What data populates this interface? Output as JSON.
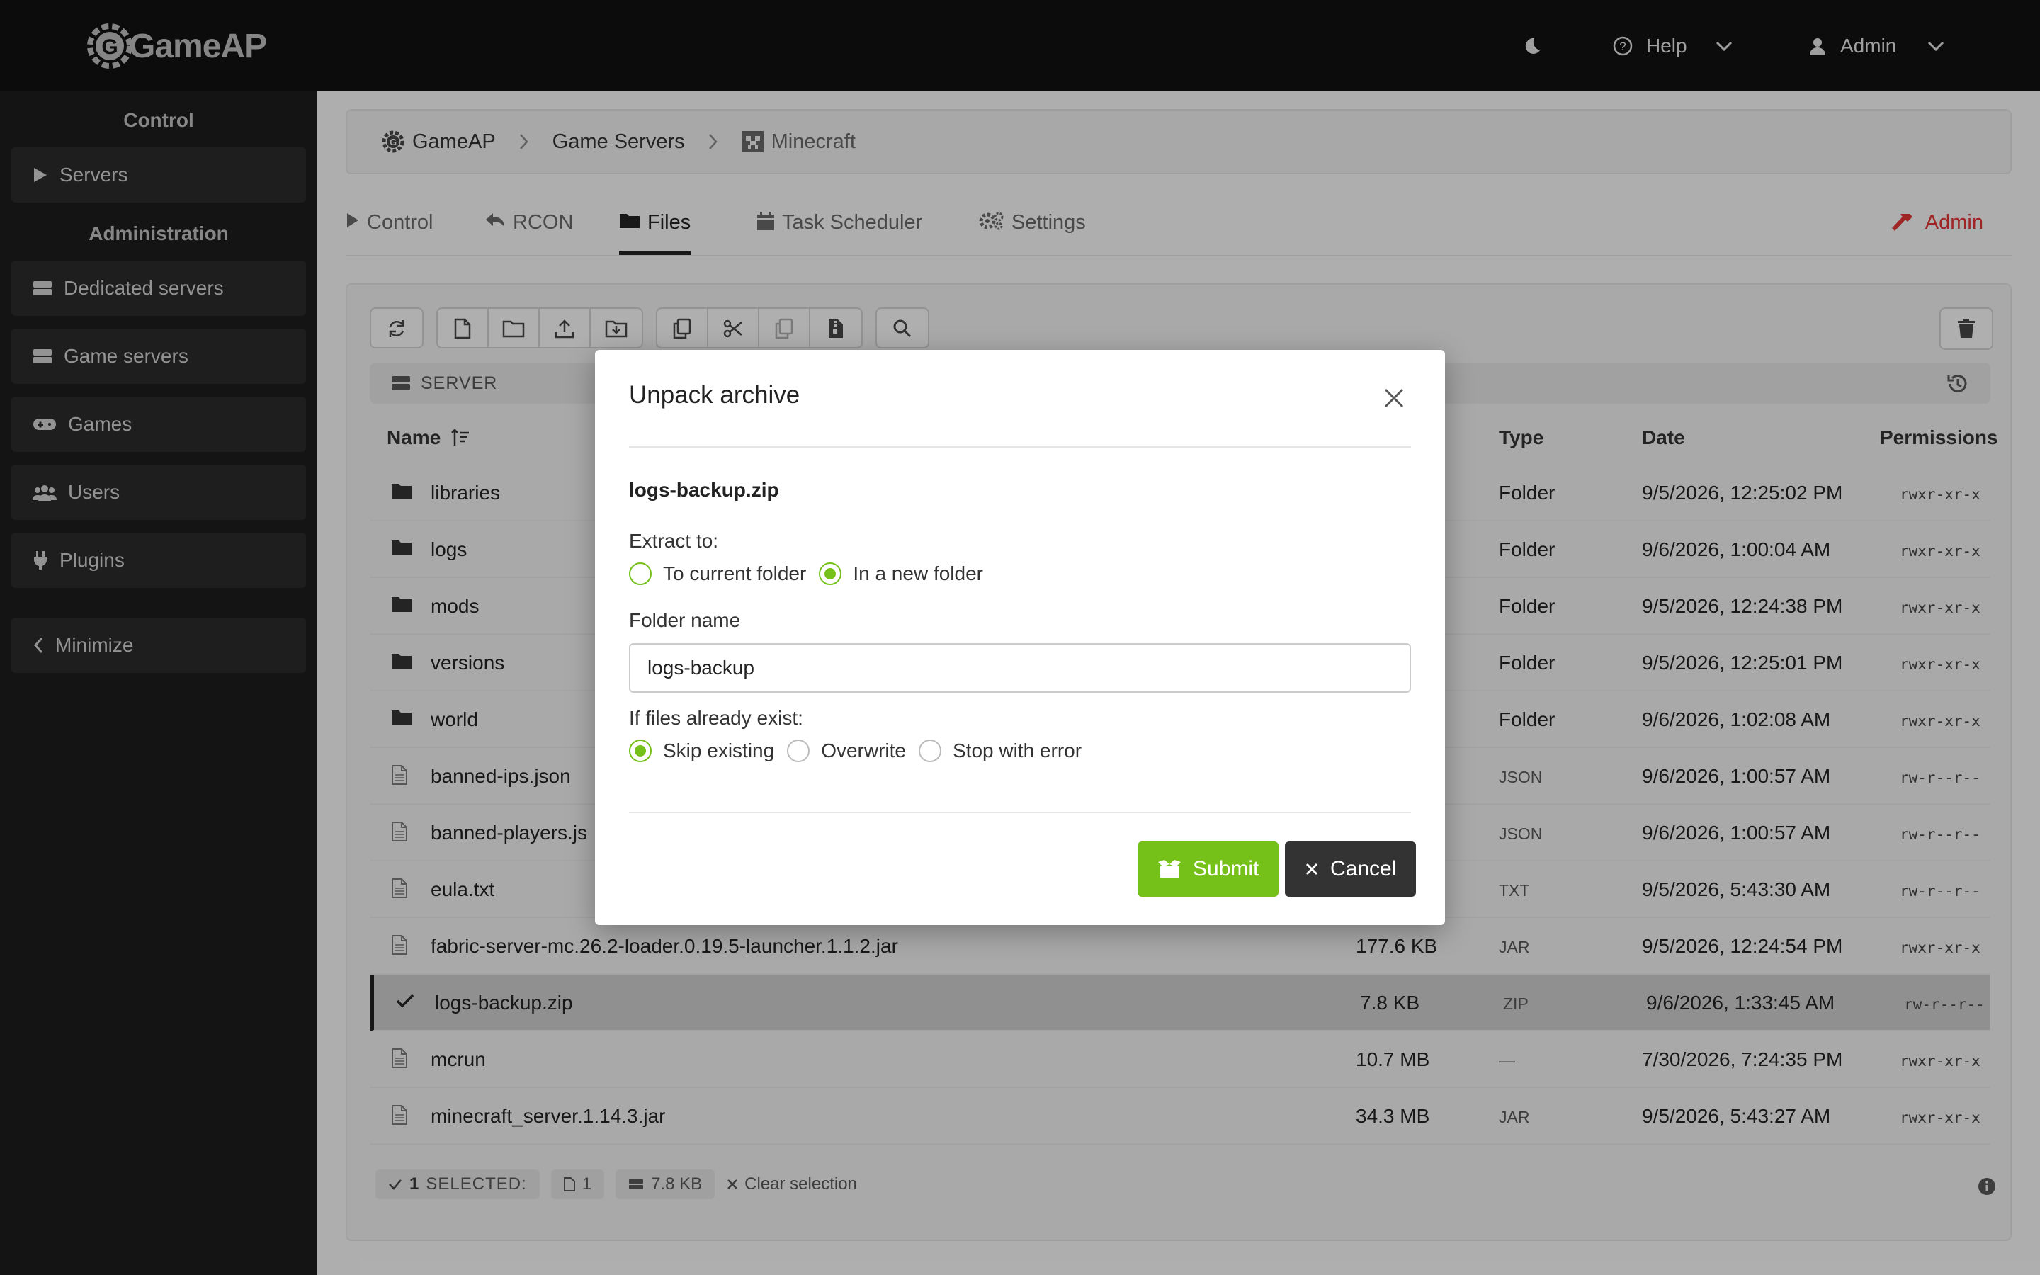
{
  "app": {
    "logo_text": "GameAP"
  },
  "topbar": {
    "help_label": "Help",
    "user_label": "Admin"
  },
  "sidebar": {
    "control_heading": "Control",
    "servers_label": "Servers",
    "admin_heading": "Administration",
    "items": [
      {
        "label": "Dedicated servers",
        "icon": "server-icon"
      },
      {
        "label": "Game servers",
        "icon": "server-icon"
      },
      {
        "label": "Games",
        "icon": "gamepad-icon"
      },
      {
        "label": "Users",
        "icon": "users-icon"
      },
      {
        "label": "Plugins",
        "icon": "plug-icon"
      }
    ],
    "minimize_label": "Minimize"
  },
  "breadcrumb": {
    "items": [
      "GameAP",
      "Game Servers",
      "Minecraft"
    ]
  },
  "tabs": {
    "items": [
      "Control",
      "RCON",
      "Files",
      "Task Scheduler",
      "Settings"
    ],
    "active": "Files",
    "admin_label": "Admin"
  },
  "files": {
    "path_label": "SERVER",
    "columns": {
      "name": "Name",
      "type": "Type",
      "date": "Date",
      "permissions": "Permissions"
    },
    "rows": [
      {
        "name": "libraries",
        "size": "",
        "type": "Folder",
        "date": "9/5/2026, 12:25:02 PM",
        "perm": "rwxr-xr-x"
      },
      {
        "name": "logs",
        "size": "",
        "type": "Folder",
        "date": "9/6/2026, 1:00:04 AM",
        "perm": "rwxr-xr-x"
      },
      {
        "name": "mods",
        "size": "",
        "type": "Folder",
        "date": "9/5/2026, 12:24:38 PM",
        "perm": "rwxr-xr-x"
      },
      {
        "name": "versions",
        "size": "",
        "type": "Folder",
        "date": "9/5/2026, 12:25:01 PM",
        "perm": "rwxr-xr-x"
      },
      {
        "name": "world",
        "size": "",
        "type": "Folder",
        "date": "9/6/2026, 1:02:08 AM",
        "perm": "rwxr-xr-x"
      },
      {
        "name": "banned-ips.json",
        "size": "",
        "type": "JSON",
        "date": "9/6/2026, 1:00:57 AM",
        "perm": "rw-r--r--"
      },
      {
        "name": "banned-players.js",
        "size": "",
        "type": "JSON",
        "date": "9/6/2026, 1:00:57 AM",
        "perm": "rw-r--r--"
      },
      {
        "name": "eula.txt",
        "size": "",
        "type": "TXT",
        "date": "9/5/2026, 5:43:30 AM",
        "perm": "rw-r--r--"
      },
      {
        "name": "fabric-server-mc.26.2-loader.0.19.5-launcher.1.1.2.jar",
        "size": "177.6 KB",
        "type": "JAR",
        "date": "9/5/2026, 12:24:54 PM",
        "perm": "rwxr-xr-x"
      },
      {
        "name": "logs-backup.zip",
        "size": "7.8 KB",
        "type": "ZIP",
        "date": "9/6/2026, 1:33:45 AM",
        "perm": "rw-r--r--",
        "selected": true
      },
      {
        "name": "mcrun",
        "size": "10.7 MB",
        "type": "—",
        "date": "7/30/2026, 7:24:35 PM",
        "perm": "rwxr-xr-x"
      },
      {
        "name": "minecraft_server.1.14.3.jar",
        "size": "34.3 MB",
        "type": "JAR",
        "date": "9/5/2026, 5:43:27 AM",
        "perm": "rwxr-xr-x"
      }
    ],
    "footer": {
      "selected_count": "1",
      "selected_label": "SELECTED:",
      "file_count": "1",
      "total_size": "7.8 KB",
      "clear_label": "Clear selection"
    }
  },
  "modal": {
    "title": "Unpack archive",
    "filename": "logs-backup.zip",
    "extract_label": "Extract to:",
    "extract_options": [
      "To current folder",
      "In a new folder"
    ],
    "extract_selected": "In a new folder",
    "folder_label": "Folder name",
    "folder_value": "logs-backup",
    "exist_label": "If files already exist:",
    "exist_options": [
      "Skip existing",
      "Overwrite",
      "Stop with error"
    ],
    "exist_selected": "Skip existing",
    "submit_label": "Submit",
    "cancel_label": "Cancel"
  },
  "colors": {
    "accent": "#76c01a",
    "danger": "#d33333",
    "dark": "#111111"
  }
}
